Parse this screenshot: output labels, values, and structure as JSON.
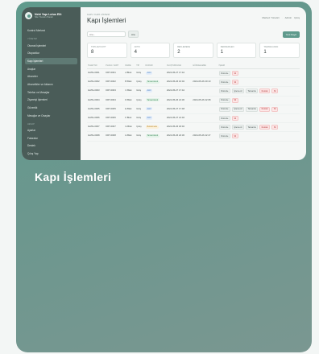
{
  "caption": "Kapı İşlemleri",
  "brand": {
    "title": "Nebi Yapı Lotus Elit",
    "subtitle": "Site Yönetim Paneli"
  },
  "sidebar": {
    "sections": [
      {
        "label": "",
        "items": [
          {
            "label": "Kontrol Merkezi",
            "active": false
          }
        ]
      },
      {
        "label": "Yönetim",
        "items": [
          {
            "label": "Otomat İşlemleri",
            "active": false
          },
          {
            "label": "Otoparklar",
            "active": false
          },
          {
            "label": "Kapı İşlemleri",
            "active": true
          },
          {
            "label": "Araçlar",
            "active": false
          },
          {
            "label": "Aboneler",
            "active": false
          },
          {
            "label": "Abonelikler ve Aktarım",
            "active": false
          },
          {
            "label": "Telefon ve Mesajlar",
            "active": false
          },
          {
            "label": "Ziyaretçi İşlemleri",
            "active": false
          },
          {
            "label": "Güvenlik",
            "active": false
          },
          {
            "label": "Mesajlar ve Onaylar",
            "active": false
          }
        ]
      },
      {
        "label": "Hesap",
        "items": [
          {
            "label": "Ayarlar",
            "active": false
          },
          {
            "label": "Faturalar",
            "active": false
          },
          {
            "label": "Destek",
            "active": false
          },
          {
            "label": "Çıkış Yap",
            "active": false
          }
        ]
      }
    ]
  },
  "header": {
    "breadcrumb": "KAPI / KAPI LİSTESİ",
    "title": "Kapı İşlemleri",
    "user": "Merkez Yönetici",
    "role": "Admin",
    "logout": "Çıkış"
  },
  "toolbar": {
    "search_placeholder": "Ara...",
    "search_button": "Ara",
    "new_button": "Yeni Kayıt"
  },
  "stats": [
    {
      "label": "Toplam Kayıt",
      "value": "8"
    },
    {
      "label": "Aktif",
      "value": "4"
    },
    {
      "label": "Beklemede",
      "value": "2"
    },
    {
      "label": "Reddedilen",
      "value": "1"
    },
    {
      "label": "Tamamlanan",
      "value": "1"
    }
  ],
  "table": {
    "columns": [
      "Talep No",
      "Plaka / Kart",
      "Daire",
      "Tip",
      "Durum",
      "Oluşturulma",
      "Güncelleme",
      "İşlem"
    ],
    "rows": [
      {
        "no": "GATE-0001",
        "card": "KRT-0001",
        "unit": "A Blok",
        "type": "Giriş",
        "status": "Aktif",
        "status_color": "#4a7fc0",
        "status_bg": "#e4eefa",
        "created": "2024-05-27 17:42",
        "updated": "",
        "actions": [
          "Düzenle",
          "Sil"
        ]
      },
      {
        "no": "GATE-0002",
        "card": "KRT-0002",
        "unit": "B Blok",
        "type": "Çıkış",
        "status": "Tamamlandı",
        "status_color": "#3d8a5c",
        "status_bg": "#e3f3e8",
        "created": "2024-05-26 16:02",
        "updated": "2024-05-26 20:10",
        "actions": [
          "Düzenle",
          "Sil"
        ]
      },
      {
        "no": "GATE-0003",
        "card": "KRT-0003",
        "unit": "C Blok",
        "type": "Giriş",
        "status": "Aktif",
        "status_color": "#4a7fc0",
        "status_bg": "#e4eefa",
        "created": "2024-05-27 17:42",
        "updated": "",
        "actions": [
          "Düzenle",
          "İşleme Al",
          "Tamamla",
          "Reddet",
          "Sil"
        ]
      },
      {
        "no": "GATE-0004",
        "card": "KRT-0004",
        "unit": "D Blok",
        "type": "Çıkış",
        "status": "Tamamlandı",
        "status_color": "#3d8a5c",
        "status_bg": "#e3f3e8",
        "created": "2024-05-26 21:30",
        "updated": "2024-05-26 22:08",
        "actions": [
          "Düzenle",
          "Sil"
        ]
      },
      {
        "no": "GATE-0005",
        "card": "KRT-0005",
        "unit": "E Blok",
        "type": "Giriş",
        "status": "Aktif",
        "status_color": "#4a7fc0",
        "status_bg": "#e4eefa",
        "created": "2024-05-27 17:48",
        "updated": "",
        "actions": [
          "Düzenle",
          "İşleme Al",
          "Tamamla",
          "Reddet",
          "Sil"
        ]
      },
      {
        "no": "GATE-0006",
        "card": "KRT-0006",
        "unit": "F Blok",
        "type": "Giriş",
        "status": "Aktif",
        "status_color": "#4a7fc0",
        "status_bg": "#e4eefa",
        "created": "2024-05-27 21:46",
        "updated": "",
        "actions": [
          "Düzenle",
          "Sil"
        ]
      },
      {
        "no": "GATE-0007",
        "card": "KRT-0007",
        "unit": "G Blok",
        "type": "Çıkış",
        "status": "Beklemede",
        "status_color": "#b7872a",
        "status_bg": "#fbf0d9",
        "created": "2024-05-26 18:40",
        "updated": "",
        "actions": [
          "Düzenle",
          "İşleme Al",
          "Tamamla",
          "Reddet",
          "Sil"
        ]
      },
      {
        "no": "GATE-0008",
        "card": "KRT-0008",
        "unit": "H Blok",
        "type": "Giriş",
        "status": "Tamamlandı",
        "status_color": "#3d8a5c",
        "status_bg": "#e3f3e8",
        "created": "2024-05-26 22:30",
        "updated": "2024-05-26 22:47",
        "actions": [
          "Düzenle",
          "Sil"
        ]
      }
    ]
  }
}
